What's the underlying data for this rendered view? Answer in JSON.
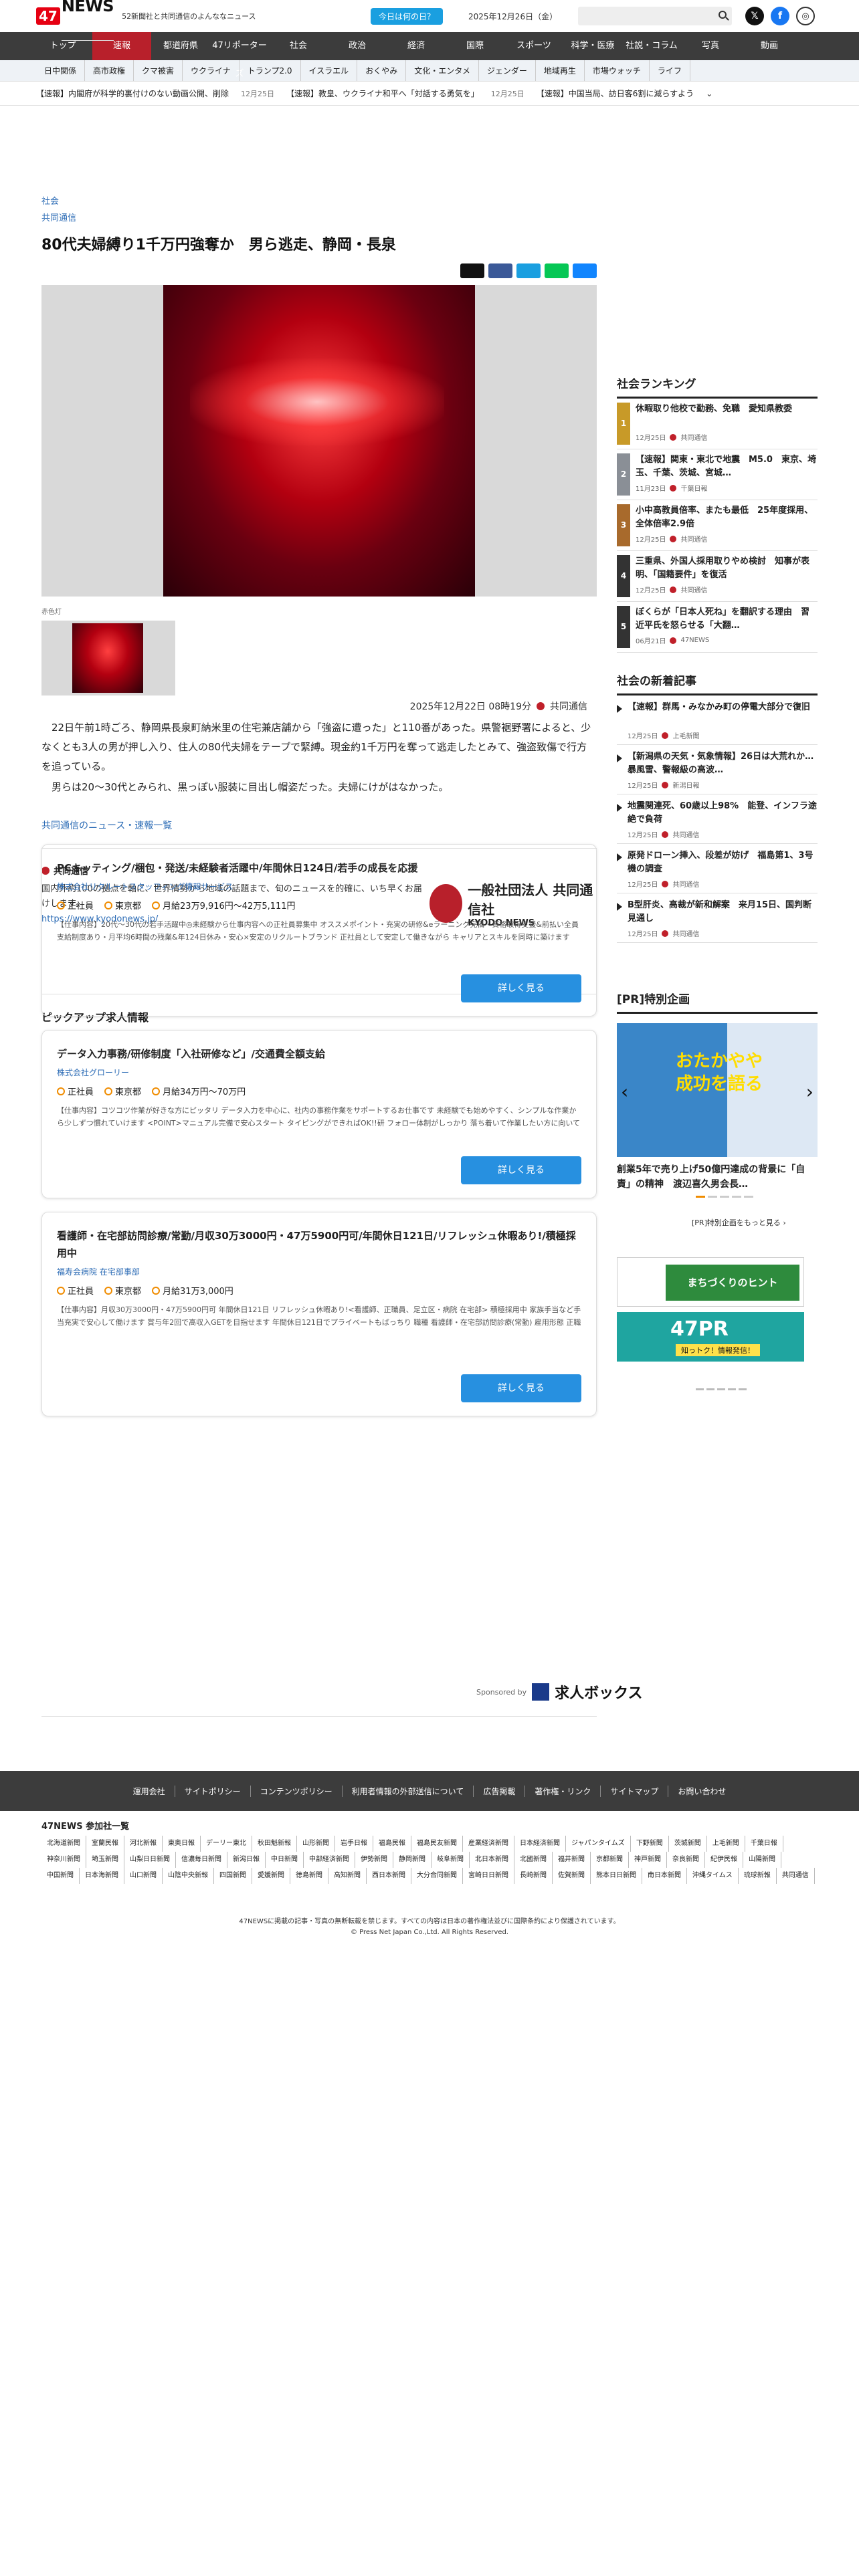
{
  "header": {
    "logo_47": "47",
    "logo_news": "NEWS",
    "tagline": "52新聞社と共同通信のよんななニュース",
    "day_button": "今日は何の日？",
    "date": "2025年12月26日（金）",
    "search_placeholder": ""
  },
  "nav_main": [
    "トップ",
    "速報",
    "都道府県",
    "47リポーターズ",
    "社会",
    "政治",
    "経済",
    "国際",
    "スポーツ",
    "科学・医療",
    "社説・コラム",
    "写真",
    "動画"
  ],
  "nav_sub": [
    "日中関係",
    "高市政権",
    "クマ被害",
    "ウクライナ",
    "トランプ2.0",
    "イスラエル",
    "おくやみ",
    "文化・エンタメ",
    "ジェンダー",
    "地域再生",
    "市場ウォッチ",
    "ライフ"
  ],
  "ticker": [
    {
      "text": "【速報】内閣府が科学的裏付けのない動画公開、削除",
      "date": "12月25日"
    },
    {
      "text": "【速報】教皇、ウクライナ和平へ「対話する勇気を」",
      "date": "12月25日"
    },
    {
      "text": "【速報】中国当局、訪日客6割に減らすよう",
      "date": ""
    }
  ],
  "article": {
    "category": "社会",
    "agency": "共同通信",
    "title": "80代夫婦縛り1千万円強奪か　男ら逃走、静岡・長泉",
    "photo_credit": "赤色灯",
    "datetime": "2025年12月22日 08時19分",
    "source": "共同通信",
    "paragraphs": [
      "22日午前1時ごろ、静岡県長泉町納米里の住宅兼店舗から「強盗に遭った」と110番があった。県警裾野署によると、少なくとも3人の男が押し入り、住人の80代夫婦をテープで緊縛。現金約1千万円を奪って逃走したとみて、強盗致傷で行方を追っている。",
      "男らは20〜30代とみられ、黒っぽい服装に目出し帽姿だった。夫婦にけがはなかった。"
    ],
    "more_link": "共同通信のニュース・速報一覧"
  },
  "kyodo": {
    "title": "共同通信",
    "desc": "国内外約100の拠点を軸に、世界情勢から地域の話題まで、旬のニュースを的確に、いち早くお届けします。",
    "url": "https://www.kyodonews.jp/",
    "logo_line1": "一般社団法人 共同通信社",
    "logo_line2": "KYODO NEWS"
  },
  "jobs": {
    "heading": "ピックアップ求人情報",
    "items": [
      {
        "title": "PCキッティング/梱包・発送/未経験者活躍中/年間休日124日/若手の成長を応援",
        "company": "株式会社リクルートスタッフィング情報サービス",
        "type": "正社員",
        "place": "東京都",
        "salary": "月給23万9,916円〜42万5,111円",
        "desc": "【仕事内容】20代〜30代の若手活躍中◎未経験から仕事内容への正社員募集中 オススメポイント・充実の研修&eラーニング完備・資格取得支援&前払い全員支給制度あり・月平均6時間の残業&年124日休み・安心×安定のリクルートブランド 正社員として安定して働きながら キャリアとスキルを同時に築けます「IT業界に興味はあるけど経験がない方」「ワークライフバランスを大切に...",
        "button": "詳しく見る"
      },
      {
        "title": "データ入力事務/研修制度「入社研修など」/交通費全額支給",
        "company": "株式会社グローリー",
        "type": "正社員",
        "place": "東京都",
        "salary": "月給34万円〜70万円",
        "desc": "【仕事内容】コツコツ作業が好きな方にピッタリ データ入力を中心に、社内の事務作業をサポートするお仕事です 未経験でも始めやすく、シンプルな作業から少しずつ慣れていけます <POINT>マニュアル完備で安心スタート タイピングができればOK!!研 フォロー体制がしっかり 落ち着いて作業したい方に向いています <仕事内容>・データ入力、チェック作業・書類作成のサポート ...",
        "button": "詳しく見る"
      },
      {
        "title": "看護師・在宅部訪問診療/常勤/月収30万3000円・47万5900円可/年間休日121日/リフレッシュ休暇あり!/積極採用中",
        "company": "福寿会病院 在宅部事部",
        "type": "正社員",
        "place": "東京都",
        "salary": "月給31万3,000円",
        "desc": "【仕事内容】月収30万3000円・47万5900円可 年間休日121日 リフレッシュ休暇あり!<看護師、正職員、足立区・病院 在宅部> 積極採用中 家族手当など手当充実で安心して働けます 賞与年2回で高収入GETを目指せます 年間休日121日でプライベートもばっちり 職種 看護師・在宅部訪問診療(常勤) 雇用形態 正職員 雇用期間 雇用期間の定めなし 給与 月収31万3000円/月...",
        "button": "詳しく見る"
      }
    ],
    "sponsored": "Sponsored by",
    "sponsor_name": "求人ボックス"
  },
  "ranking": {
    "heading": "社会ランキング",
    "items": [
      {
        "num": "1",
        "title": "休暇取り他校で勤務、免職　愛知県教委",
        "date": "12月25日",
        "src": "共同通信",
        "color": "#c89a28"
      },
      {
        "num": "2",
        "title": "【速報】関東・東北で地震　M5.0　東京、埼玉、千葉、茨城、宮城…",
        "date": "11月23日",
        "src": "千葉日報",
        "color": "#8a8f96"
      },
      {
        "num": "3",
        "title": "小中高教員倍率、またも最低　25年度採用、全体倍率2.9倍",
        "date": "12月25日",
        "src": "共同通信",
        "color": "#a86a2c"
      },
      {
        "num": "4",
        "title": "三重県、外国人採用取りやめ検討　知事が表明、「国籍要件」を復活",
        "date": "12月25日",
        "src": "共同通信",
        "color": "#333333"
      },
      {
        "num": "5",
        "title": "ぼくらが「日本人死ね」を翻訳する理由　習近平氏を怒らせる「大翻…",
        "date": "06月21日",
        "src": "47NEWS",
        "color": "#333333"
      }
    ]
  },
  "latest": {
    "heading": "社会の新着記事",
    "items": [
      {
        "title": "【速報】群馬・みなかみ町の停電大部分で復旧",
        "date": "12月25日",
        "src": "上毛新聞"
      },
      {
        "title": "【新潟県の天気・気象情報】26日は大荒れか…暴風雪、警報級の高波…",
        "date": "12月25日",
        "src": "新潟日報"
      },
      {
        "title": "地震関連死、60歳以上98%　能登、インフラ途絶で負荷",
        "date": "12月25日",
        "src": "共同通信"
      },
      {
        "title": "原発ドローン挿入、段差が妨げ　福島第1、3号機の調査",
        "date": "12月25日",
        "src": "共同通信"
      },
      {
        "title": "B型肝炎、高裁が新和解案　来月15日、国判断見通し",
        "date": "12月25日",
        "src": "共同通信"
      }
    ]
  },
  "pr": {
    "heading": "[PR]特別企画",
    "banner_big": "おたかやや\n成功を語る",
    "caption": "創業5年で売り上げ50億円達成の背景に「自責」の精神　渡辺喜久男会長…",
    "more": "[PR]特別企画をもっと見る ›",
    "ad1": "まちづくりのヒント",
    "ad2_title": "47PR",
    "ad2_sub": "知っトク！情報発信！"
  },
  "footer": {
    "links": [
      "運用会社",
      "サイトポリシー",
      "コンテンツポリシー",
      "利用者情報の外部送信について",
      "広告掲載",
      "著作権・リンク",
      "サイトマップ",
      "お問い合わせ"
    ],
    "partners_heading": "47NEWS 参加社一覧",
    "partners": [
      "北海道新聞",
      "室蘭民報",
      "河北新報",
      "東奥日報",
      "デーリー東北",
      "秋田魁新報",
      "山形新聞",
      "岩手日報",
      "福島民報",
      "福島民友新聞",
      "産業経済新聞",
      "日本経済新聞",
      "ジャパンタイムズ",
      "下野新聞",
      "茨城新聞",
      "上毛新聞",
      "千葉日報",
      "神奈川新聞",
      "埼玉新聞",
      "山梨日日新聞",
      "信濃毎日新聞",
      "新潟日報",
      "中日新聞",
      "中部経済新聞",
      "伊勢新聞",
      "静岡新聞",
      "岐阜新聞",
      "北日本新聞",
      "北國新聞",
      "福井新聞",
      "京都新聞",
      "神戸新聞",
      "奈良新聞",
      "紀伊民報",
      "山陽新聞",
      "中国新聞",
      "日本海新聞",
      "山口新聞",
      "山陰中央新報",
      "四国新聞",
      "愛媛新聞",
      "徳島新聞",
      "高知新聞",
      "西日本新聞",
      "大分合同新聞",
      "宮崎日日新聞",
      "長崎新聞",
      "佐賀新聞",
      "熊本日日新聞",
      "南日本新聞",
      "沖縄タイムス",
      "琉球新報",
      "共同通信"
    ],
    "copy1": "47NEWSに掲載の記事・写真の無断転載を禁じます。すべての内容は日本の著作権法並びに国際条約により保護されています。",
    "copy2": "© Press Net Japan Co.,Ltd. All Rights Reserved."
  }
}
